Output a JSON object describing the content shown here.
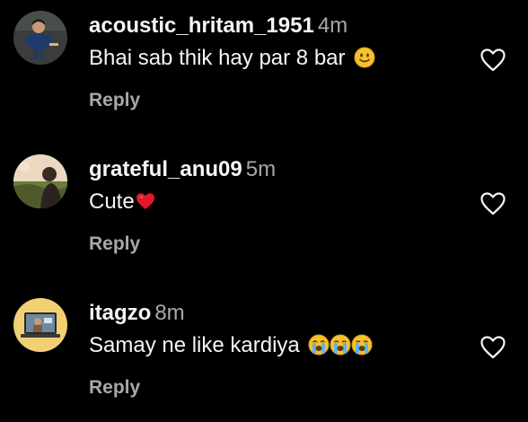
{
  "comments": [
    {
      "username": "acoustic_hritam_1951",
      "time": "4m",
      "text": "Bhai sab thik hay par 8 bar",
      "emoji": "slightly-smiling-face",
      "reply_label": "Reply",
      "liked": false
    },
    {
      "username": "grateful_anu09",
      "time": "5m",
      "text": "Cute",
      "emoji": "red-heart",
      "reply_label": "Reply",
      "liked": false
    },
    {
      "username": "itagzo",
      "time": "8m",
      "text": "Samay ne like kardiya",
      "emoji": "loudly-crying-face x3",
      "reply_label": "Reply",
      "liked": false
    }
  ],
  "colors": {
    "background": "#000000",
    "primary_text": "#f5f5f5",
    "secondary_text": "#a8a8a8",
    "heart_emoji": "#e0182d",
    "emoji_yellow": "#f6c22c"
  },
  "icons": {
    "like": "heart-outline-icon"
  }
}
